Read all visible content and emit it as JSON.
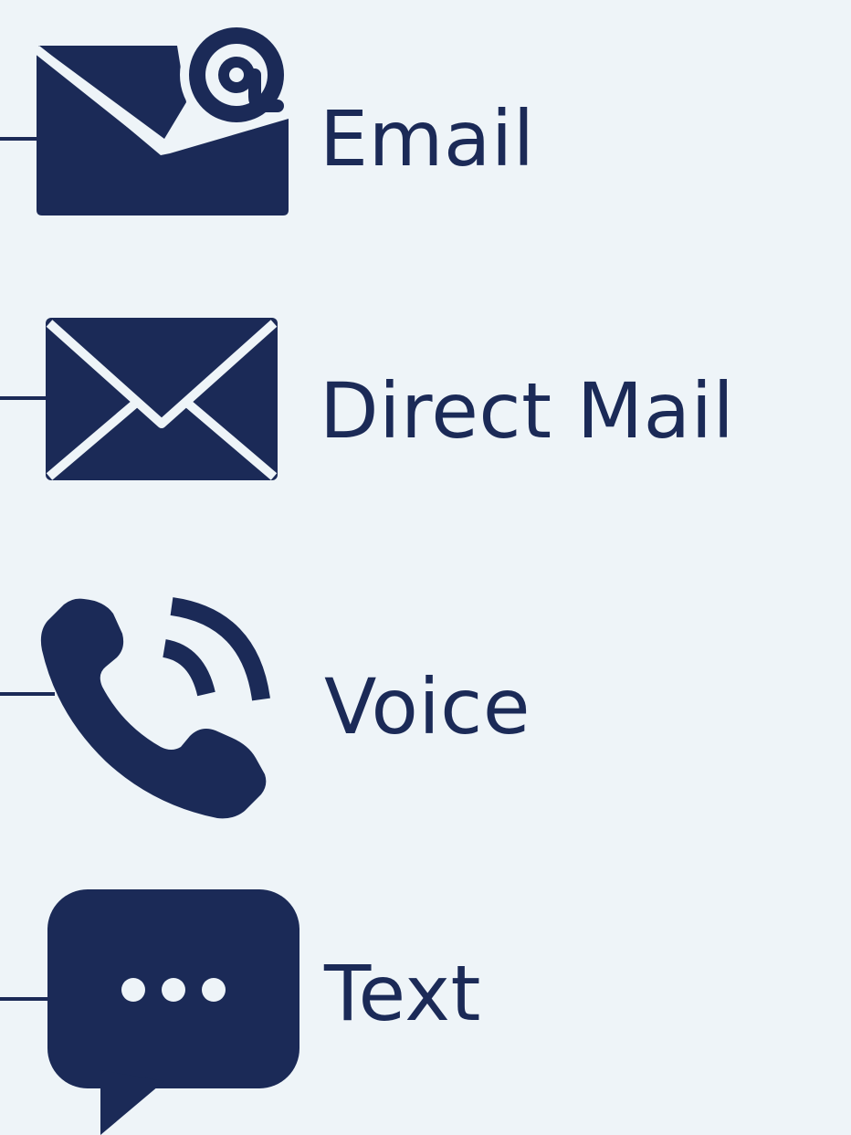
{
  "colors": {
    "background": "#eef4f8",
    "icon": "#1b2a57"
  },
  "channels": [
    {
      "label": "Email",
      "icon": "email-at-icon"
    },
    {
      "label": "Direct Mail",
      "icon": "envelope-icon"
    },
    {
      "label": "Voice",
      "icon": "phone-icon"
    },
    {
      "label": "Text",
      "icon": "chat-bubble-icon"
    }
  ]
}
